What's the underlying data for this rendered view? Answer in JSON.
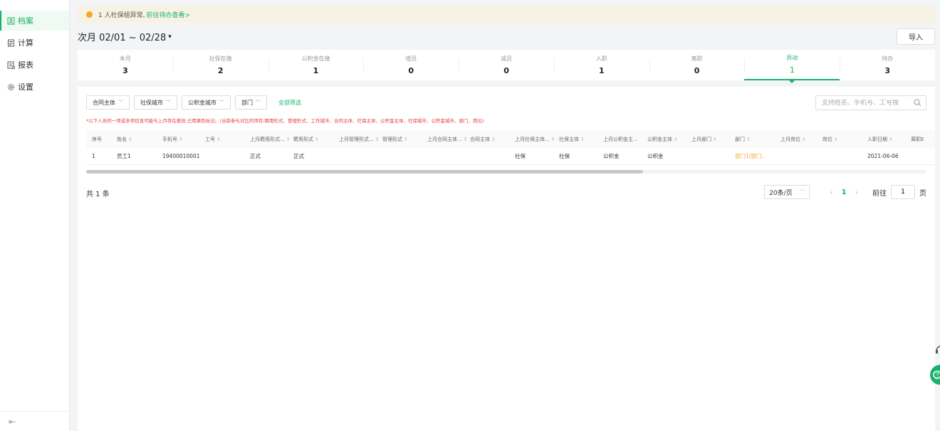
{
  "sidebar": {
    "items": [
      {
        "label": "档案",
        "icon": "archive-icon"
      },
      {
        "label": "计算",
        "icon": "calculator-icon"
      },
      {
        "label": "报表",
        "icon": "report-icon"
      },
      {
        "label": "设置",
        "icon": "gear-icon"
      }
    ],
    "collapse_icon": "⇤"
  },
  "alert": {
    "text": "1 人社保组异常,",
    "link": "前往待办查看>"
  },
  "period": {
    "label": "次月 02/01 ~ 02/28",
    "caret": "▾"
  },
  "import_label": "导入",
  "stats": [
    {
      "label": "本月",
      "value": "3"
    },
    {
      "label": "社保在缴",
      "value": "2"
    },
    {
      "label": "公积金在缴",
      "value": "1"
    },
    {
      "label": "增员",
      "value": "0"
    },
    {
      "label": "减员",
      "value": "0"
    },
    {
      "label": "入职",
      "value": "1"
    },
    {
      "label": "离职",
      "value": "0"
    },
    {
      "label": "异动",
      "value": "1"
    },
    {
      "label": "待办",
      "value": "3"
    }
  ],
  "filters": [
    "合同主体",
    "社保城市",
    "公积金城市",
    "部门"
  ],
  "all_filter": "全部筛选",
  "search_placeholder": "支持姓名、手机号、工号搜",
  "note": "*以下人员的一项或多项信息可能与上月存在差异,已用黄色标记。(当前参与对比的项有:聘用形式、管理形式、工作城市、合同主体、社保主体、公积金主体、社保城市、公积金城市、部门、岗位)",
  "table": {
    "headers": [
      "序号",
      "姓名",
      "手机号",
      "工号",
      "上月聘用形式...",
      "聘用形式",
      "上月管理形式...",
      "管理形式",
      "上月合同主体...",
      "合同主体",
      "上月社保主体...",
      "社保主体",
      "上月公积金主...",
      "公积金主体",
      "上月部门",
      "部门",
      "上月岗位",
      "岗位",
      "入职日期",
      "离职E"
    ],
    "sortable": [
      false,
      true,
      true,
      true,
      true,
      true,
      true,
      true,
      true,
      true,
      true,
      true,
      false,
      true,
      true,
      true,
      true,
      true,
      true,
      false
    ],
    "sort_glyph": "⇕",
    "rows": [
      [
        "1",
        "员工1",
        "19400010001",
        "",
        "正式",
        "正式",
        "",
        "",
        "",
        "",
        "社保",
        "社保",
        "公积金",
        "公积金",
        "",
        "部门1/部门...",
        "",
        "",
        "2021-06-06",
        ""
      ]
    ]
  },
  "total": "共 1 条",
  "pager": {
    "size": "20条/页",
    "prev": "‹",
    "current": "1",
    "next": "›",
    "goto_label": "前往",
    "goto_value": "1",
    "page_suffix": "页"
  },
  "colors": {
    "accent": "#19b26b",
    "warning": "#f5a623",
    "danger": "#e63c3c"
  }
}
